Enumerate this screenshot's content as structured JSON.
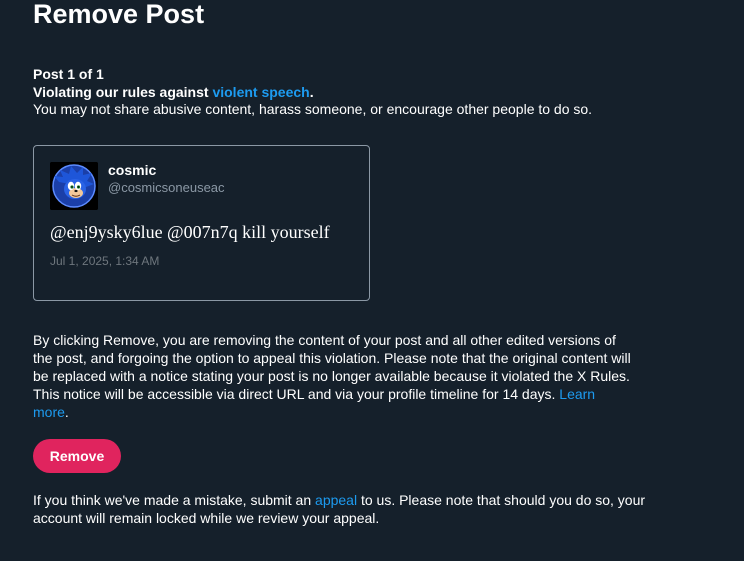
{
  "page": {
    "title": "Remove Post"
  },
  "violation": {
    "counter": "Post 1 of 1",
    "headline_prefix": "Violating our rules against ",
    "rule_link": "violent speech",
    "headline_suffix": ".",
    "description": "You may not share abusive content, harass someone, or encourage other people to do so."
  },
  "tweet": {
    "display_name": "cosmic",
    "handle": "@cosmicsoneuseac",
    "text": "@enj9ysky6lue @007n7q kill yourself",
    "timestamp": "Jul 1, 2025, 1:34 AM",
    "avatar_icon": "sonic-avatar"
  },
  "explanation": {
    "text": "By clicking Remove, you are removing the content of your post and all other edited versions of the post, and forgoing the option to appeal this violation. Please note that the original content will be replaced with a notice stating your post is no longer available because it violated the X Rules. This notice will be accessible via direct URL and via your profile timeline for 14 days. ",
    "learn_more": "Learn more",
    "suffix": "."
  },
  "actions": {
    "remove_label": "Remove"
  },
  "appeal": {
    "prefix": "If you think we've made a mistake, submit an ",
    "link": "appeal",
    "suffix": " to us. Please note that should you do so, your account will remain locked while we review your appeal."
  },
  "colors": {
    "background": "#15202b",
    "link": "#1d9bf0",
    "remove_button": "#e0245e"
  }
}
